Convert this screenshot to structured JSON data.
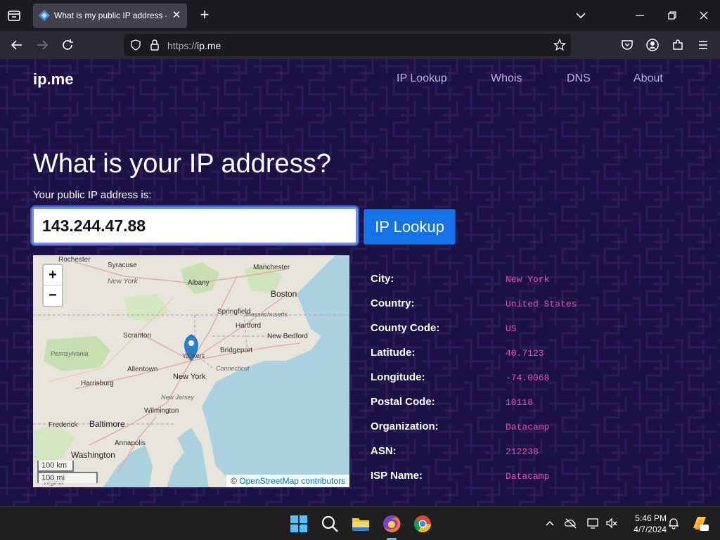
{
  "browser": {
    "tab_title": "What is my public IP address - I",
    "url_protocol": "https://",
    "url_host": "ip.me"
  },
  "site": {
    "logo": "ip.me",
    "nav": [
      "IP Lookup",
      "Whois",
      "DNS",
      "About"
    ],
    "heading": "What is your IP address?",
    "subtitle": "Your public IP address is:",
    "ip_value": "143.244.47.88",
    "lookup_button": "IP Lookup"
  },
  "map": {
    "zoom_in": "+",
    "zoom_out": "−",
    "scale_km": "100 km",
    "scale_mi": "100 mi",
    "attribution_prefix": "©",
    "attribution_link": "OpenStreetMap contributors",
    "labels": [
      "Rochester",
      "Syracuse",
      "New York",
      "Albany",
      "Manchester",
      "Boston",
      "Springfield",
      "Massachusetts",
      "Hartford",
      "New Bedford",
      "Scranton",
      "Pennsylvania",
      "Bridgeport",
      "Yonkers",
      "Connecticut",
      "Allentown",
      "New York",
      "Harrisburg",
      "New Jersey",
      "Wilmington",
      "Frederick",
      "Baltimore",
      "Annapolis",
      "Washington",
      "Virginia"
    ]
  },
  "details": [
    {
      "label": "City:",
      "value": "New York"
    },
    {
      "label": "Country:",
      "value": "United States"
    },
    {
      "label": "County Code:",
      "value": "US"
    },
    {
      "label": "Latitude:",
      "value": "40.7123"
    },
    {
      "label": "Longitude:",
      "value": "-74.0068"
    },
    {
      "label": "Postal Code:",
      "value": "10118"
    },
    {
      "label": "Organization:",
      "value": "Datacamp"
    },
    {
      "label": "ASN:",
      "value": "212238"
    },
    {
      "label": "ISP Name:",
      "value": "Datacamp"
    }
  ],
  "taskbar": {
    "time": "5:46 PM",
    "date": "4/7/2024"
  },
  "colors": {
    "page_bg": "#1d1246",
    "value_text": "#e64fa6",
    "button": "#1473e6"
  }
}
